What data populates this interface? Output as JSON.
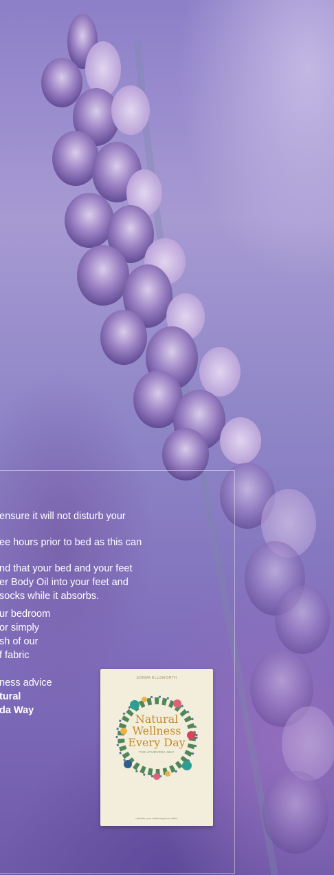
{
  "panel": {
    "lines": [
      "ensure it will not disturb your",
      "ee hours prior to bed as this can",
      "nd that your bed and your feet",
      "er Body Oil into your feet and",
      "socks while it absorbs.",
      "ur bedroom",
      "or simply",
      "sh of our",
      "f fabric",
      "ness advice",
      "tural",
      "da Way"
    ]
  },
  "book": {
    "author": "SONNA ELLSWORTH",
    "title_line1": "Natural",
    "title_line2": "Wellness",
    "title_line3": "Every Day",
    "subtitle": "THE AYURVEDA WAY",
    "footer": "rekindle your wellbeing from within"
  },
  "colors": {
    "text": "#ffffff",
    "panel_border": "rgba(255,255,255,0.45)",
    "book_cover": "#f3eedc",
    "book_title": "#c48a2a"
  }
}
